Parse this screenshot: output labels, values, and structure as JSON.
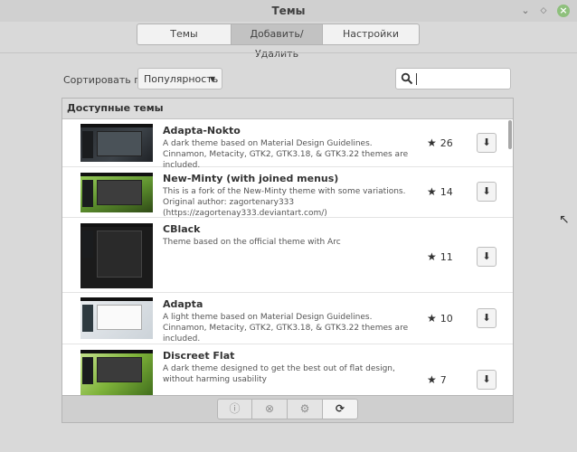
{
  "window": {
    "title": "Темы"
  },
  "tabs": [
    {
      "label": "Темы"
    },
    {
      "label": "Добавить/Удалить",
      "active": true
    },
    {
      "label": "Настройки"
    }
  ],
  "sort": {
    "label": "Сортировать по",
    "value": "Популярность"
  },
  "search": {
    "placeholder": ""
  },
  "panel": {
    "header": "Доступные темы"
  },
  "themes": [
    {
      "name": "Adapta-Nokto",
      "description": "A dark theme based on Material Design Guidelines. Cinnamon, Metacity, GTK2, GTK3.18, & GTK3.22 themes are included.",
      "rating": "26"
    },
    {
      "name": "New-Minty (with joined menus)",
      "description": "This is a fork of the New-Minty theme with some variations. Original author: zagortenary333 (https://zagortenay333.deviantart.com/)",
      "rating": "14"
    },
    {
      "name": "CBlack",
      "description": "Theme based on the official theme with Arc",
      "rating": "11"
    },
    {
      "name": "Adapta",
      "description": "A light theme based on Material Design Guidelines. Cinnamon, Metacity, GTK2, GTK3.18, & GTK3.22 themes are included.",
      "rating": "10"
    },
    {
      "name": "Discreet Flat",
      "description": "A dark theme designed to get the best out of flat design, without harming usability",
      "rating": "7"
    }
  ],
  "bottom_toolbar": {
    "buttons": [
      {
        "icon": "info-icon"
      },
      {
        "icon": "remove-icon"
      },
      {
        "icon": "gear-icon"
      },
      {
        "icon": "refresh-icon"
      }
    ]
  }
}
